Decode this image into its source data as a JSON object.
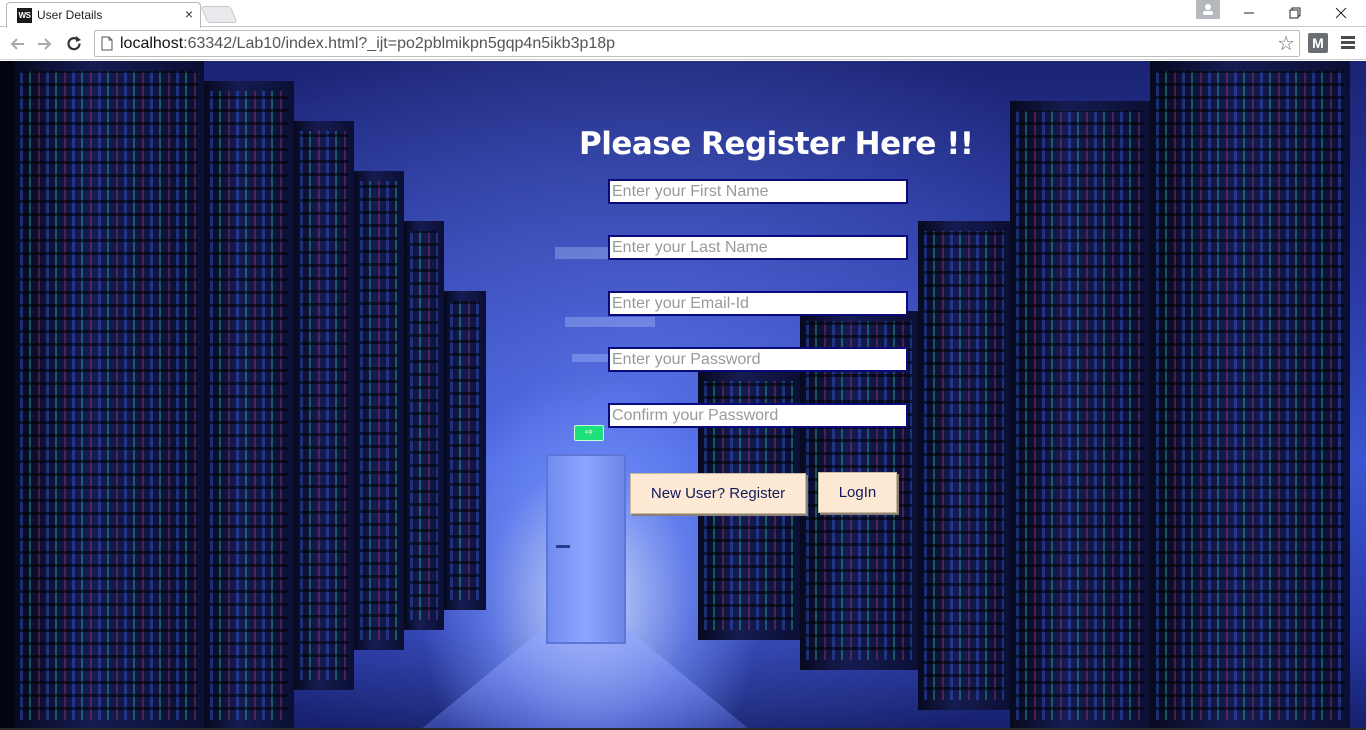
{
  "browser": {
    "tab": {
      "favicon": "WS",
      "title": "User Details",
      "close_icon": "×"
    },
    "address": {
      "host": "localhost",
      "rest": ":63342/Lab10/index.html?_ijt=po2pblmikpn5gqp4n5ikb3p18p"
    },
    "bookmark_icon": "☆",
    "extension_label": "M"
  },
  "page": {
    "title": "Please Register Here !!",
    "fields": {
      "first_name": "Enter your First Name",
      "last_name": "Enter your Last Name",
      "email": "Enter your Email-Id",
      "password": "Enter your Password",
      "confirm_password": "Confirm your Password"
    },
    "buttons": {
      "register": "New User? Register",
      "login": "LogIn"
    }
  },
  "colors": {
    "title_text": "#ffffff",
    "field_border": "#0a0a7a",
    "button_bg": "#fde9d4",
    "button_text": "#111a5c"
  }
}
